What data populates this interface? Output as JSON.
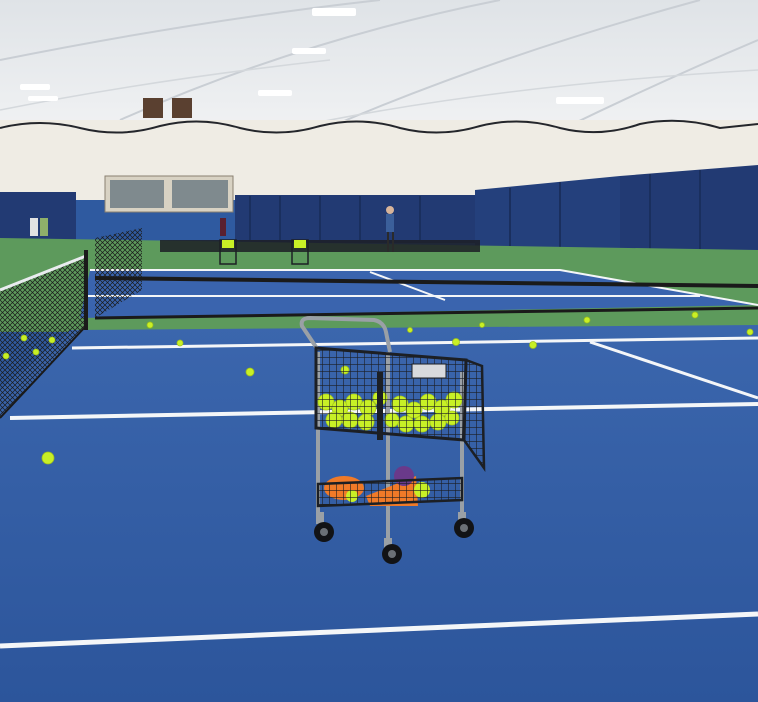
{
  "scene": {
    "subject": "ball-cart",
    "colors": {
      "ceiling": "#e9ecef",
      "ceiling_shadow": "#c9ced4",
      "wall": "#efece4",
      "curtain": "#223a73",
      "court_blue": "#2f5aa0",
      "court_blue_far": "#3a64ae",
      "court_green": "#5d9a5c",
      "line": "#f4f6f8",
      "tennis_ball": "#c8f026",
      "cone_orange": "#f07a28",
      "cart_metal": "#9aa0a6",
      "basket": "#1c1f24"
    }
  }
}
